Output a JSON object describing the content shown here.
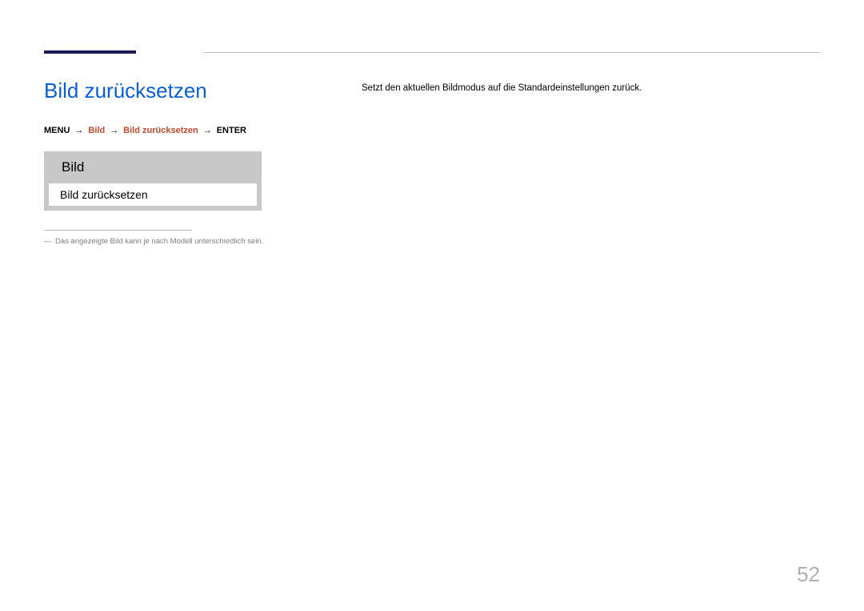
{
  "page": {
    "title": "Bild zurücksetzen",
    "number": "52"
  },
  "breadcrumb": {
    "menu": "MENU",
    "arrow": "→",
    "crumb1": "Bild",
    "crumb2": "Bild zurücksetzen",
    "enter": "ENTER"
  },
  "menu_mock": {
    "title": "Bild",
    "item": "Bild zurücksetzen"
  },
  "footnote": {
    "marker": "―",
    "text": "Das angezeigte Bild kann je nach Modell unterschiedlich sein."
  },
  "description": "Setzt den aktuellen Bildmodus auf die Standardeinstellungen zurück."
}
